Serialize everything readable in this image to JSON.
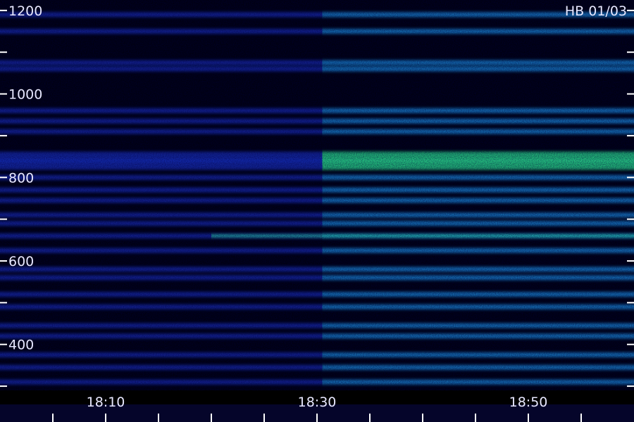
{
  "chart_data": {
    "type": "heatmap",
    "title": "HB 01/03",
    "xlabel": "",
    "ylabel": "",
    "y_tick_labels": [
      "1200",
      "1000",
      "800",
      "600",
      "400"
    ],
    "y_ticks": [
      1200,
      1100,
      1000,
      900,
      800,
      700,
      600,
      500,
      400,
      300
    ],
    "ylim": [
      290,
      1225
    ],
    "x_tick_labels": [
      "18:10",
      "18:30",
      "18:50"
    ],
    "x_tick_minutes": [
      10,
      30,
      50
    ],
    "xlim_minutes": [
      0,
      60
    ],
    "brightening_time_minutes": 30.5,
    "emission_bands": [
      1190,
      1150,
      1075,
      1060,
      960,
      935,
      910,
      850,
      830,
      800,
      770,
      745,
      710,
      690,
      660,
      625,
      580,
      560,
      520,
      490,
      445,
      420,
      375,
      345,
      310
    ],
    "narrow_line": 660,
    "colormap": [
      "#000010",
      "#1010a0",
      "#2040ff",
      "#20a0ff",
      "#30ffa0"
    ],
    "grid": false
  }
}
